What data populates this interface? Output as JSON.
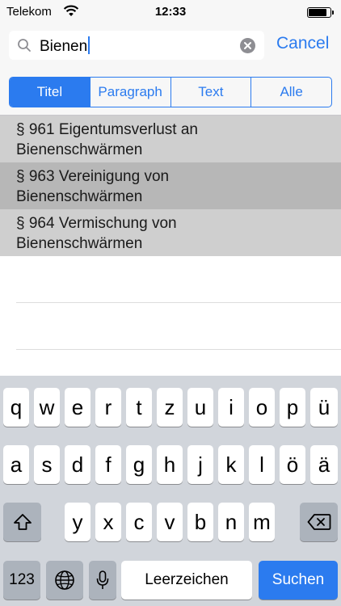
{
  "status_bar": {
    "carrier": "Telekom",
    "time": "12:33",
    "battery_level": 0.85
  },
  "search": {
    "query": "Bienen",
    "cancel_label": "Cancel"
  },
  "scope_tabs": [
    {
      "label": "Titel",
      "selected": true
    },
    {
      "label": "Paragraph",
      "selected": false
    },
    {
      "label": "Text",
      "selected": false
    },
    {
      "label": "Alle",
      "selected": false
    }
  ],
  "results": [
    {
      "line1": "§ 961 Eigentumsverlust an",
      "line2": "Bienenschwärmen",
      "highlighted": false
    },
    {
      "line1": "§ 963 Vereinigung von",
      "line2": "Bienenschwärmen",
      "highlighted": true
    },
    {
      "line1": "§ 964 Vermischung von",
      "line2": "Bienenschwärmen",
      "highlighted": false
    }
  ],
  "keyboard": {
    "row1": [
      "q",
      "w",
      "e",
      "r",
      "t",
      "z",
      "u",
      "i",
      "o",
      "p",
      "ü"
    ],
    "row2": [
      "a",
      "s",
      "d",
      "f",
      "g",
      "h",
      "j",
      "k",
      "l",
      "ö",
      "ä"
    ],
    "row3": [
      "y",
      "x",
      "c",
      "v",
      "b",
      "n",
      "m"
    ],
    "numbers_label": "123",
    "space_label": "Leerzeichen",
    "search_label": "Suchen"
  },
  "colors": {
    "accent": "#2b7bef",
    "keyboard_bg": "#d1d5db",
    "result_bg": "#cfcfcf",
    "result_highlight": "#b7b7b7"
  }
}
